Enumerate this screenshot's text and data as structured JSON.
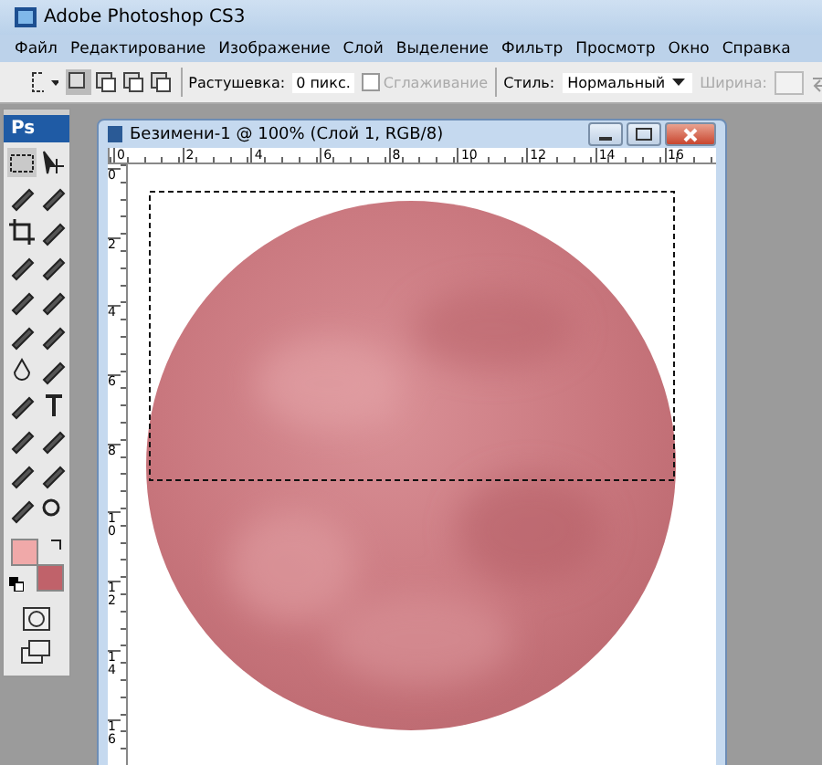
{
  "window": {
    "title": "Adobe Photoshop CS3"
  },
  "menu": [
    "Файл",
    "Редактирование",
    "Изображение",
    "Слой",
    "Выделение",
    "Фильтр",
    "Просмотр",
    "Окно",
    "Справка"
  ],
  "options_bar": {
    "feather_label": "Растушевка:",
    "feather_value": "0 пикс.",
    "antialias": {
      "label": "Сглаживание",
      "checked": false,
      "disabled": true
    },
    "style_label": "Стиль:",
    "style_value": "Нормальный",
    "width_label": "Ширина:",
    "width_disabled": true
  },
  "tools_panel": {
    "logo": "Ps",
    "swatches": [
      {
        "kind": "foreground",
        "color": "#f0a9a9"
      },
      {
        "kind": "background",
        "color": "#c0626a"
      }
    ]
  },
  "document": {
    "title": "Безимени-1 @ 100% (Слой 1, RGB/8)",
    "top_ruler": [
      "0",
      "2",
      "4",
      "6",
      "8",
      "10",
      "12",
      "14",
      "16"
    ],
    "left_ruler": [
      "0",
      "2",
      "4",
      "6",
      "8",
      "10",
      "12",
      "14",
      "16"
    ]
  }
}
